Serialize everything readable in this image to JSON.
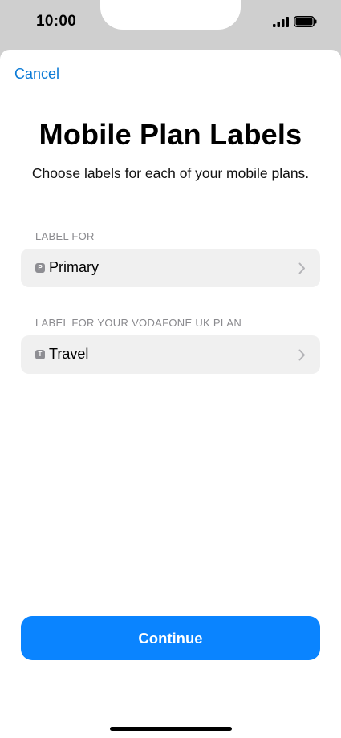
{
  "status_bar": {
    "time": "10:00",
    "signal_icon": "cellular-signal-icon",
    "battery_icon": "battery-full-icon"
  },
  "sheet": {
    "cancel_label": "Cancel",
    "title": "Mobile Plan Labels",
    "subtitle": "Choose labels for each of your mobile plans.",
    "sections": [
      {
        "header": "LABEL FOR",
        "badge": "P",
        "value": "Primary"
      },
      {
        "header": "LABEL FOR YOUR VODAFONE UK PLAN",
        "badge": "T",
        "value": "Travel"
      }
    ],
    "continue_label": "Continue"
  },
  "colors": {
    "accent": "#0a84ff",
    "link": "#0a7ad6",
    "row_background": "#f0f0f0",
    "secondary_text": "#8a8a8e"
  }
}
